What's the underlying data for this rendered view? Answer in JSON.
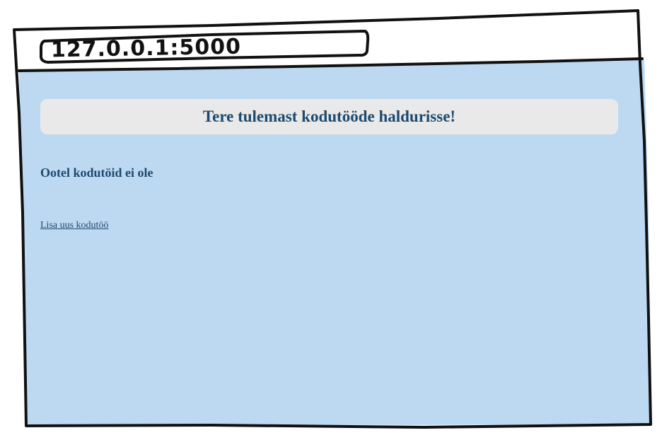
{
  "browser": {
    "address_bar": "127.0.0.1:5000"
  },
  "page": {
    "header_title": "Tere tulemast kodutööde haldurisse!",
    "pending_heading": "Ootel kodutöid ei ole",
    "add_link": "Lisa uus kodutöö"
  },
  "colors": {
    "page_background": "#bdd9f1",
    "banner_background": "#e9e9ea",
    "text_primary": "#1d4a6e",
    "sketch_stroke": "#111111"
  }
}
